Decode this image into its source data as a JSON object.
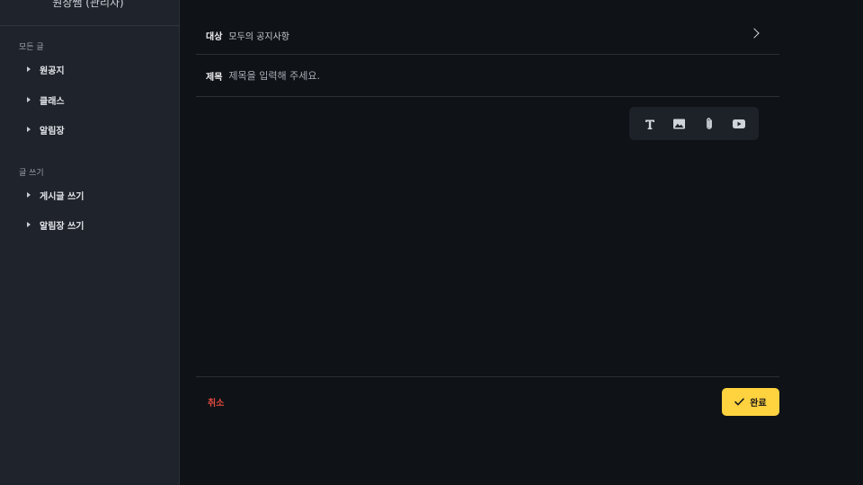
{
  "sidebar": {
    "header_title": "원장쌤 (관리자)",
    "sections": [
      {
        "label": "모든 글",
        "items": [
          {
            "label": "원공지"
          },
          {
            "label": "클래스"
          },
          {
            "label": "알림장"
          }
        ]
      },
      {
        "label": "글 쓰기",
        "items": [
          {
            "label": "게시글 쓰기"
          },
          {
            "label": "알림장 쓰기"
          }
        ]
      }
    ]
  },
  "editor": {
    "target_label": "대상",
    "target_value": "모두의 공지사항",
    "title_label": "제목",
    "title_placeholder": "제목을 입력해 주세요.",
    "title_value": "",
    "toolbar_icons": [
      "text-icon",
      "image-icon",
      "paperclip-icon",
      "video-icon"
    ]
  },
  "footer": {
    "cancel_label": "취소",
    "done_label": "완료"
  },
  "colors": {
    "accent": "#ffd23f",
    "danger": "#e0483e",
    "sidebar_bg": "#1f232b",
    "main_bg": "#0f1216"
  }
}
